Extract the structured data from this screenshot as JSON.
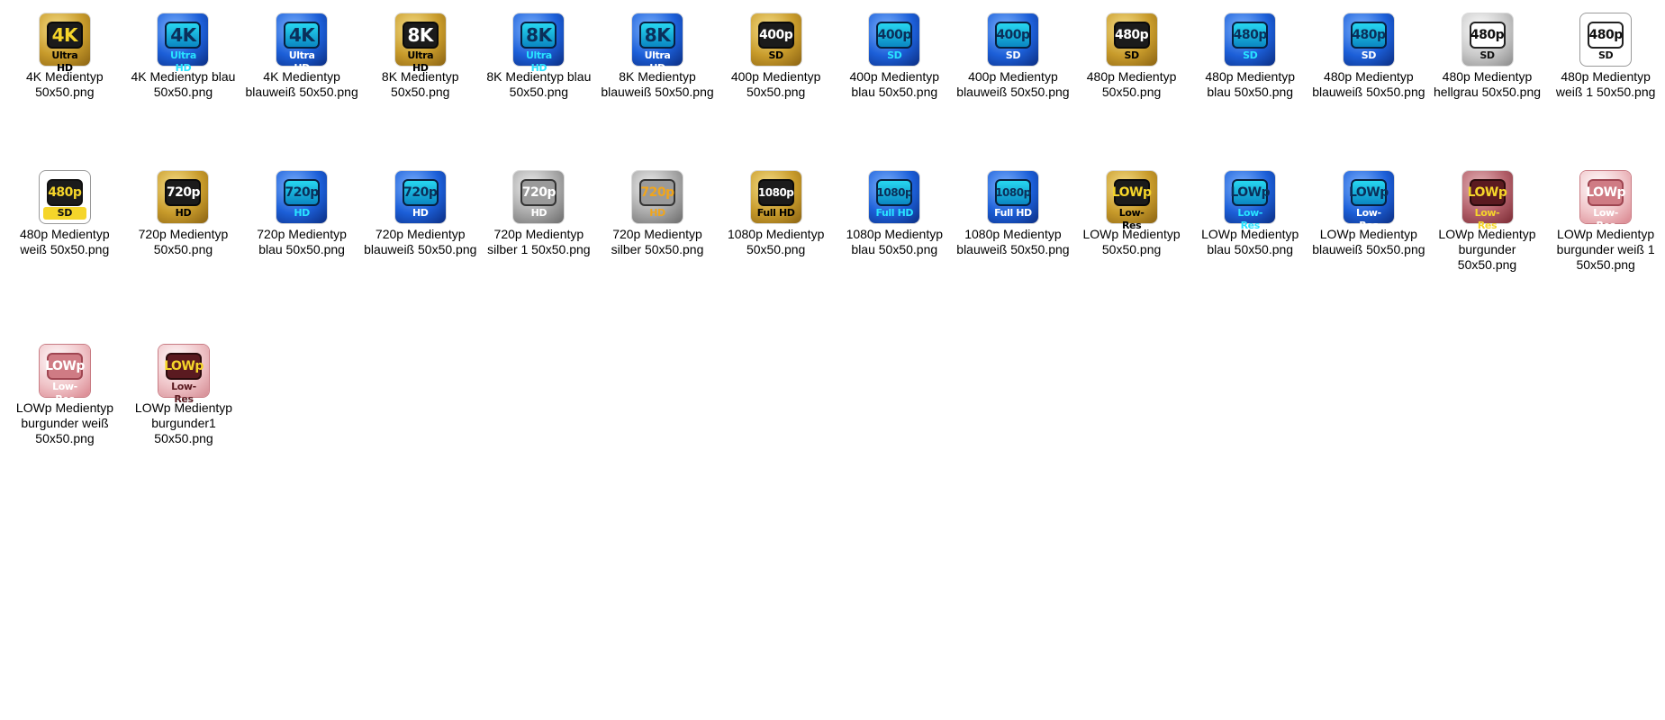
{
  "rows": [
    [
      {
        "label": "4K Medientyp 50x50.png",
        "icon_name": "4k-media-type-icon",
        "badge": "4K",
        "sub": "Ultra HD",
        "style": "gold y"
      },
      {
        "label": "4K Medientyp blau 50x50.png",
        "icon_name": "4k-media-type-blue-icon",
        "badge": "4K",
        "sub": "Ultra HD",
        "style": "blue"
      },
      {
        "label": "4K Medientyp blauweiß 50x50.png",
        "icon_name": "4k-media-type-bluewhite-icon",
        "badge": "4K",
        "sub": "Ultra HD",
        "style": "bluew"
      },
      {
        "label": "8K Medientyp 50x50.png",
        "icon_name": "8k-media-type-icon",
        "badge": "8K",
        "sub": "Ultra HD",
        "style": "gold"
      },
      {
        "label": "8K Medientyp blau 50x50.png",
        "icon_name": "8k-media-type-blue-icon",
        "badge": "8K",
        "sub": "Ultra HD",
        "style": "blue"
      },
      {
        "label": "8K Medientyp blauweiß 50x50.png",
        "icon_name": "8k-media-type-bluewhite-icon",
        "badge": "8K",
        "sub": "Ultra HD",
        "style": "bluew"
      },
      {
        "label": "400p Medientyp 50x50.png",
        "icon_name": "400p-media-type-icon",
        "badge": "400p",
        "sub": "SD",
        "style": "gold"
      },
      {
        "label": "400p Medientyp blau 50x50.png",
        "icon_name": "400p-media-type-blue-icon",
        "badge": "400p",
        "sub": "SD",
        "style": "blue"
      },
      {
        "label": "400p Medientyp blauweiß 50x50.png",
        "icon_name": "400p-media-type-bluewhite-icon",
        "badge": "400p",
        "sub": "SD",
        "style": "bluew"
      },
      {
        "label": "480p Medientyp 50x50.png",
        "icon_name": "480p-media-type-icon",
        "badge": "480p",
        "sub": "SD",
        "style": "gold"
      },
      {
        "label": "480p Medientyp blau 50x50.png",
        "icon_name": "480p-media-type-blue-icon",
        "badge": "480p",
        "sub": "SD",
        "style": "blue"
      },
      {
        "label": "480p Medientyp blauweiß 50x50.png",
        "icon_name": "480p-media-type-bluewhite-icon",
        "badge": "480p",
        "sub": "SD",
        "style": "bluew"
      },
      {
        "label": "480p Medientyp hellgrau 50x50.png",
        "icon_name": "480p-media-type-lightgray-icon",
        "badge": "480p",
        "sub": "SD",
        "style": "gray"
      },
      {
        "label": "480p Medientyp weiß 1 50x50.png",
        "icon_name": "480p-media-type-white-1-icon",
        "badge": "480p",
        "sub": "SD",
        "style": "white"
      }
    ],
    [
      {
        "label": "480p Medientyp weiß 50x50.png",
        "icon_name": "480p-media-type-white-icon",
        "badge": "480p",
        "sub": "SD",
        "style": "whitey"
      },
      {
        "label": "720p Medientyp 50x50.png",
        "icon_name": "720p-media-type-icon",
        "badge": "720p",
        "sub": "HD",
        "style": "gold"
      },
      {
        "label": "720p Medientyp blau 50x50.png",
        "icon_name": "720p-media-type-blue-icon",
        "badge": "720p",
        "sub": "HD",
        "style": "blue"
      },
      {
        "label": "720p Medientyp blauweiß 50x50.png",
        "icon_name": "720p-media-type-bluewhite-icon",
        "badge": "720p",
        "sub": "HD",
        "style": "bluew"
      },
      {
        "label": "720p Medientyp silber 1 50x50.png",
        "icon_name": "720p-media-type-silver-1-icon",
        "badge": "720p",
        "sub": "HD",
        "style": "silver"
      },
      {
        "label": "720p Medientyp silber 50x50.png",
        "icon_name": "720p-media-type-silver-icon",
        "badge": "720p",
        "sub": "HD",
        "style": "silver o"
      },
      {
        "label": "1080p Medientyp 50x50.png",
        "icon_name": "1080p-media-type-icon",
        "badge": "1080p",
        "sub": "Full HD",
        "style": "gold"
      },
      {
        "label": "1080p Medientyp blau 50x50.png",
        "icon_name": "1080p-media-type-blue-icon",
        "badge": "1080p",
        "sub": "Full HD",
        "style": "blue"
      },
      {
        "label": "1080p Medientyp blauweiß 50x50.png",
        "icon_name": "1080p-media-type-bluewhite-icon",
        "badge": "1080p",
        "sub": "Full HD",
        "style": "bluew"
      },
      {
        "label": "LOWp Medientyp 50x50.png",
        "icon_name": "lowp-media-type-icon",
        "badge": "LOWp",
        "sub": "Low-Res",
        "style": "gold y"
      },
      {
        "label": "LOWp Medientyp blau 50x50.png",
        "icon_name": "lowp-media-type-blue-icon",
        "badge": "LOWp",
        "sub": "Low-Res",
        "style": "blue"
      },
      {
        "label": "LOWp Medientyp blauweiß 50x50.png",
        "icon_name": "lowp-media-type-bluewhite-icon",
        "badge": "LOWp",
        "sub": "Low-Res",
        "style": "bluew"
      },
      {
        "label": "LOWp Medientyp burgunder 50x50.png",
        "icon_name": "lowp-media-type-burgundy-icon",
        "badge": "LOWp",
        "sub": "Low-Res",
        "style": "burg"
      },
      {
        "label": "LOWp Medientyp burgunder weiß 1 50x50.png",
        "icon_name": "lowp-media-type-burgundy-white-1-icon",
        "badge": "LOWp",
        "sub": "Low-Res",
        "style": "burgw"
      }
    ],
    [
      {
        "label": "LOWp Medientyp burgunder weiß 50x50.png",
        "icon_name": "lowp-media-type-burgundy-white-icon",
        "badge": "LOWp",
        "sub": "Low-Res",
        "style": "burgw"
      },
      {
        "label": "LOWp Medientyp burgunder1 50x50.png",
        "icon_name": "lowp-media-type-burgundy1-icon",
        "badge": "LOWp",
        "sub": "Low-Res",
        "style": "burg1"
      }
    ]
  ]
}
